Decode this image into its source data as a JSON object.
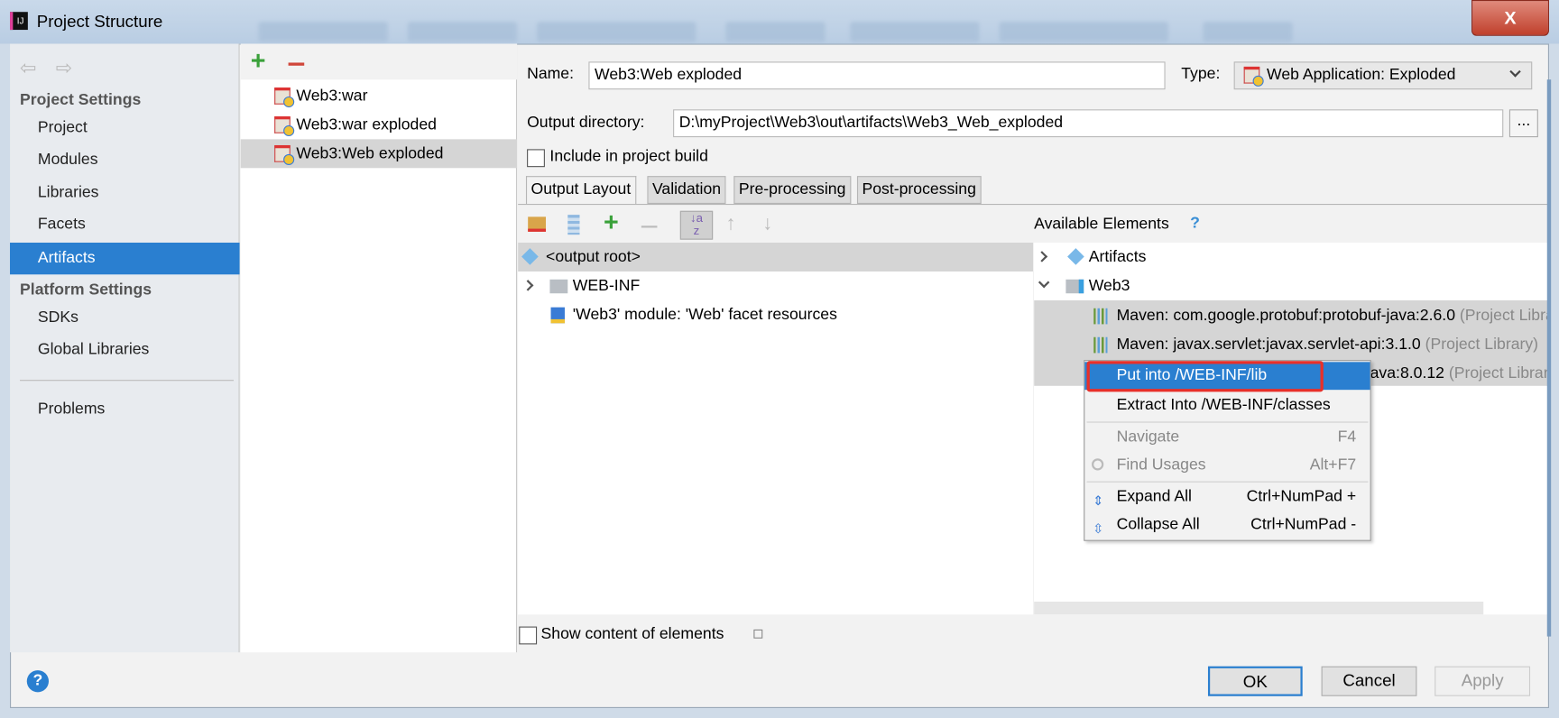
{
  "window": {
    "title": "Project Structure",
    "close_label": "X"
  },
  "sidebar": {
    "project_settings_header": "Project Settings",
    "items": [
      {
        "label": "Project"
      },
      {
        "label": "Modules"
      },
      {
        "label": "Libraries"
      },
      {
        "label": "Facets"
      },
      {
        "label": "Artifacts",
        "selected": true
      }
    ],
    "platform_settings_header": "Platform Settings",
    "platform_items": [
      {
        "label": "SDKs"
      },
      {
        "label": "Global Libraries"
      }
    ],
    "problems": "Problems"
  },
  "artifacts": {
    "items": [
      {
        "label": "Web3:war"
      },
      {
        "label": "Web3:war exploded"
      },
      {
        "label": "Web3:Web exploded",
        "selected": true
      }
    ]
  },
  "form": {
    "name_label": "Name:",
    "name_value": "Web3:Web exploded",
    "type_label": "Type:",
    "type_value": "Web Application: Exploded",
    "output_label": "Output directory:",
    "output_value": "D:\\myProject\\Web3\\out\\artifacts\\Web3_Web_exploded",
    "browse_label": "...",
    "include_label": "Include in project build",
    "include_checked": false
  },
  "tabs": [
    {
      "label": "Output Layout",
      "active": true
    },
    {
      "label": "Validation"
    },
    {
      "label": "Pre-processing"
    },
    {
      "label": "Post-processing"
    }
  ],
  "layout_tree": [
    {
      "label": "<output root>"
    },
    {
      "label": "WEB-INF"
    },
    {
      "label": "'Web3' module: 'Web' facet resources"
    }
  ],
  "available": {
    "title": "Available Elements",
    "help": "?",
    "artifacts": "Artifacts",
    "web3": "Web3",
    "libs": [
      {
        "name": "Maven: com.google.protobuf:protobuf-java:2.6.0",
        "suffix": "(Project Library)"
      },
      {
        "name": "Maven: javax.servlet:javax.servlet-api:3.1.0",
        "suffix": "(Project Library)"
      },
      {
        "name": "ava:8.0.12",
        "suffix": "(Project Library)"
      }
    ]
  },
  "context_menu": [
    {
      "label": "Put into /WEB-INF/lib",
      "highlighted": true
    },
    {
      "label": "Extract Into /WEB-INF/classes"
    },
    {
      "label": "Navigate",
      "shortcut": "F4",
      "disabled": true
    },
    {
      "label": "Find Usages",
      "shortcut": "Alt+F7",
      "disabled": true
    },
    {
      "label": "Expand All",
      "shortcut": "Ctrl+NumPad +"
    },
    {
      "label": "Collapse All",
      "shortcut": "Ctrl+NumPad -"
    }
  ],
  "show_content_label": "Show content of elements",
  "buttons": {
    "ok": "OK",
    "cancel": "Cancel",
    "apply": "Apply",
    "help": "?"
  },
  "colors": {
    "selection": "#2a7fd0",
    "highlight_box": "#e8302a"
  }
}
